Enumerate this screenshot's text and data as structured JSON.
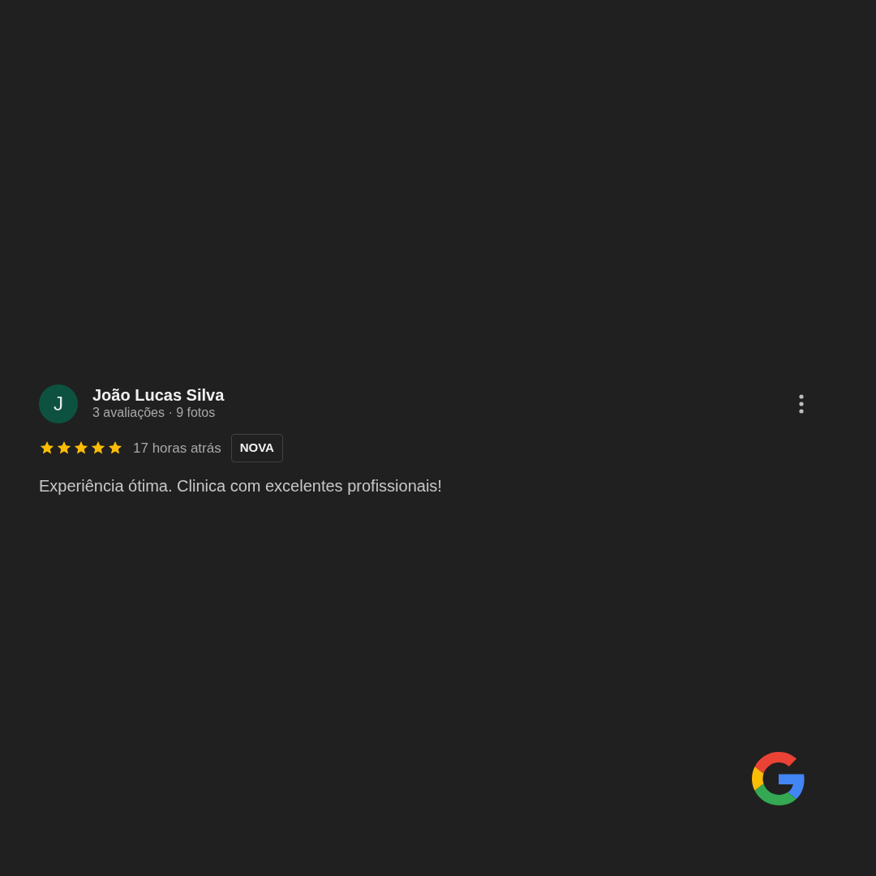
{
  "review": {
    "avatar_letter": "J",
    "author": "João Lucas Silva",
    "meta": "3 avaliações · 9 fotos",
    "stars": 5,
    "time": "17 horas atrás",
    "badge": "NOVA",
    "text": "Experiência ótima. Clinica com excelentes profissionais!"
  }
}
